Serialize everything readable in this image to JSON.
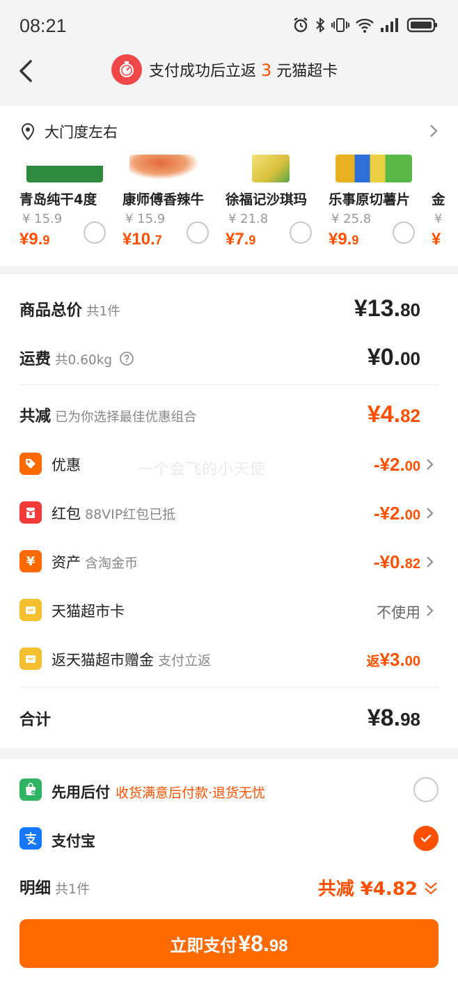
{
  "status_bar": {
    "time": "08:21"
  },
  "header": {
    "promo_prefix": "支付成功后立返",
    "promo_amount": "3",
    "promo_suffix": "元猫超卡"
  },
  "address": {
    "label": "大门度左右"
  },
  "products": [
    {
      "name": "青岛纯干4度",
      "original_price": "¥ 15.9",
      "price_int": "¥9.",
      "price_dec": "9",
      "img_color": "#2e8b3e"
    },
    {
      "name": "康师傅香辣牛",
      "original_price": "¥ 15.9",
      "price_int": "¥10.",
      "price_dec": "7",
      "img_color": "#e46a3a"
    },
    {
      "name": "徐福记沙琪玛",
      "original_price": "¥ 21.8",
      "price_int": "¥7.",
      "price_dec": "9",
      "img_color": "#d8c03a"
    },
    {
      "name": "乐事原切薯片",
      "original_price": "¥ 25.8",
      "price_int": "¥9.",
      "price_dec": "9",
      "img_color": "#e8b020"
    }
  ],
  "summary": {
    "goods_label": "商品总价",
    "goods_count": "共1件",
    "goods_int": "¥13.",
    "goods_dec": "80",
    "shipping_label": "运费",
    "shipping_weight": "共0.60kg",
    "shipping_int": "¥0.",
    "shipping_dec": "00",
    "discount_label": "共减",
    "discount_note": "已为你选择最佳优惠组合",
    "discount_int": "¥4.",
    "discount_dec": "82",
    "items": [
      {
        "label": "优惠",
        "sub": "",
        "value_int": "-¥2.",
        "value_dec": "00",
        "icon": "tag-icon",
        "color": "#ff6a00"
      },
      {
        "label": "红包",
        "sub": "88VIP红包已抵",
        "value_int": "-¥2.",
        "value_dec": "00",
        "icon": "red-packet-icon",
        "color": "#f23a3a"
      },
      {
        "label": "资产",
        "sub": "含淘金币",
        "value_int": "-¥0.",
        "value_dec": "82",
        "icon": "yen-icon",
        "color": "#ff6a00"
      },
      {
        "label": "天猫超市卡",
        "sub": "",
        "value_text": "不使用",
        "icon": "card-icon",
        "color": "#f5c030"
      },
      {
        "label": "返天猫超市赠金",
        "sub": "支付立返",
        "value_prefix": "返",
        "value_int": "¥3.",
        "value_dec": "00",
        "icon": "card-icon",
        "color": "#f5c030"
      }
    ],
    "total_label": "合计",
    "total_int": "¥8.",
    "total_dec": "98"
  },
  "watermark": "一个会飞的小天使",
  "payment": {
    "option1_label": "先用后付",
    "option1_sub": "收货满意后付款·退货无忧",
    "option2_label": "支付宝",
    "detail_label": "明细",
    "detail_count": "共1件",
    "detail_total": "共减 ¥4.82",
    "pay_label": "立即支付",
    "pay_int": "¥8.",
    "pay_dec": "98"
  }
}
